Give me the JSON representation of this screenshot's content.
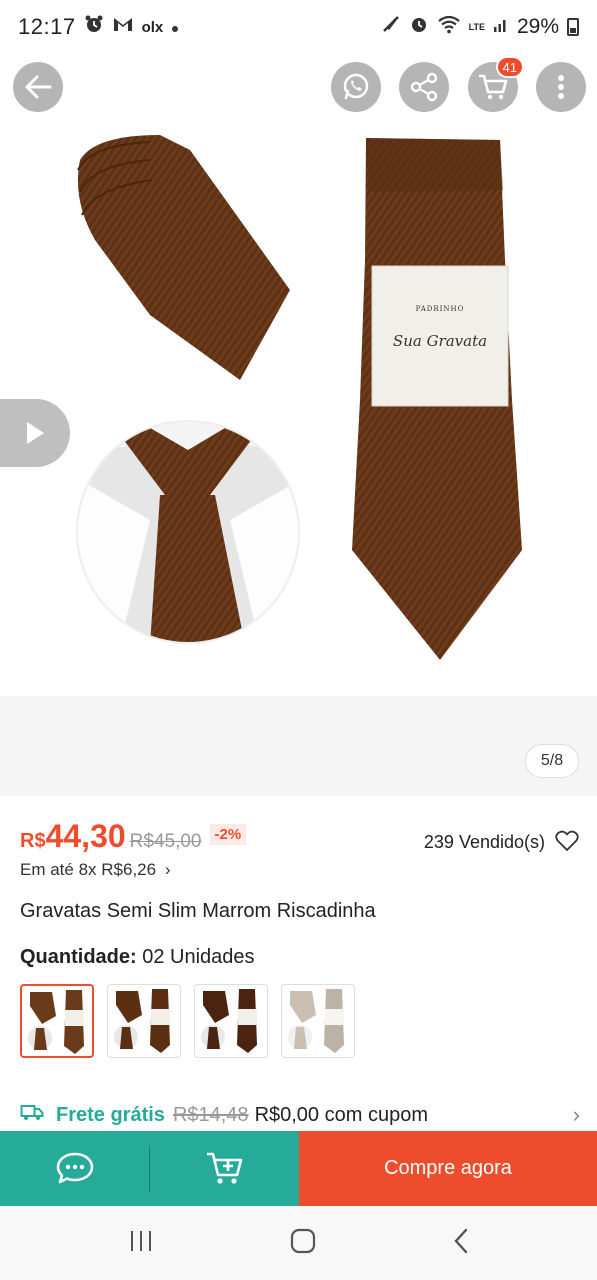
{
  "status_bar": {
    "time": "12:17",
    "carrier_glyph": "olx",
    "battery": "29%",
    "net_label": "LTE"
  },
  "header": {
    "back_icon": "arrow-left-icon",
    "whatsapp_icon": "whatsapp-icon",
    "share_icon": "share-icon",
    "cart_icon": "cart-icon",
    "cart_badge": "41",
    "more_icon": "more-vertical-icon"
  },
  "gallery": {
    "page_indicator": "5/8",
    "band_brand": "PADRINHO",
    "band_script": "Sua Gravata"
  },
  "product": {
    "currency": "R$",
    "price": "44,30",
    "old_price": "R$45,00",
    "discount": "-2%",
    "sold": "239 Vendido(s)",
    "installments": "Em até 8x R$6,26",
    "installments_chevron": "›",
    "title": "Gravatas Semi Slim Marrom Riscadinha",
    "quantity_label": "Quantidade:",
    "quantity_value": "02 Unidades"
  },
  "shipping": {
    "label": "Frete grátis",
    "old_price": "R$14,48",
    "rest": "R$0,00 com cupom",
    "chevron": "›"
  },
  "bottom_bar": {
    "buy_now": "Compre agora"
  },
  "colors": {
    "accent": "#ee4d2d",
    "teal": "#26aa99",
    "tie_brown": "#6b3a1a"
  }
}
